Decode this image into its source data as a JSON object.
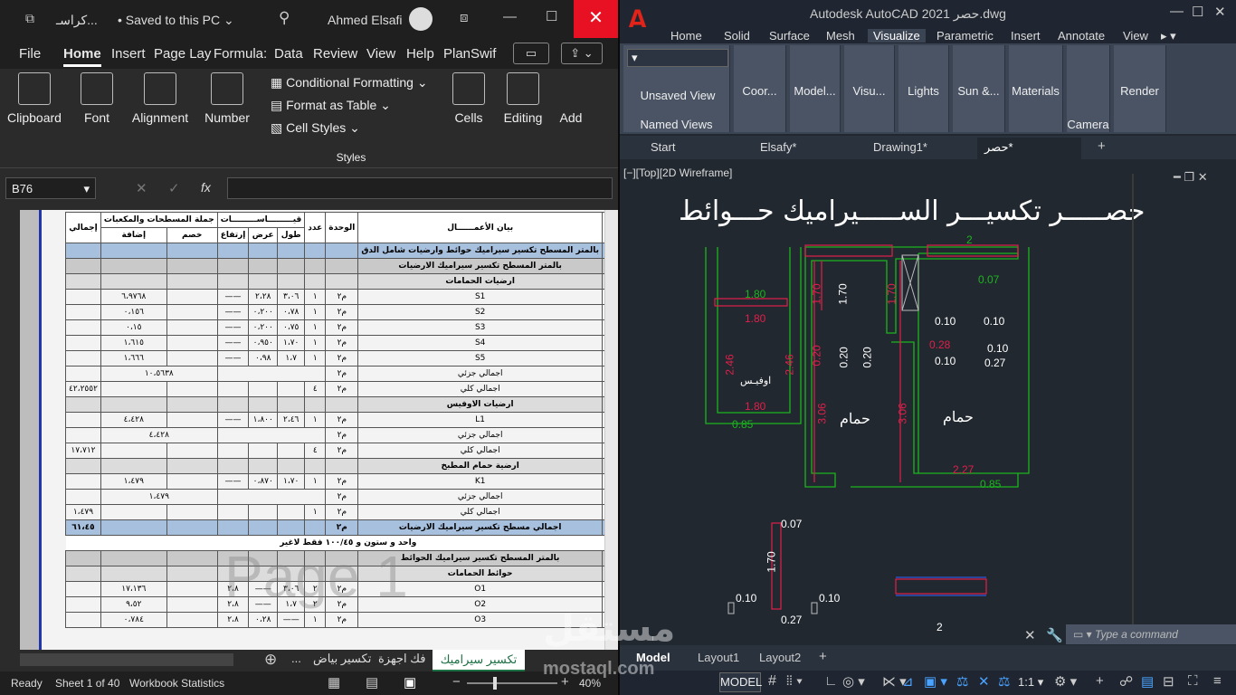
{
  "excel": {
    "title": {
      "filename": "كراسـ...",
      "saved": "Saved to this PC",
      "user": "Ahmed Elsafi"
    },
    "menu": [
      "File",
      "Home",
      "Insert",
      "Page Lay",
      "Formula:",
      "Data",
      "Review",
      "View",
      "Help",
      "PlanSwif"
    ],
    "ribbon": {
      "clipboard": "Clipboard",
      "font": "Font",
      "alignment": "Alignment",
      "number": "Number",
      "conditional": "Conditional Formatting",
      "format_table": "Format as Table",
      "cell_styles": "Cell Styles",
      "styles": "Styles",
      "cells": "Cells",
      "editing": "Editing",
      "add": "Add"
    },
    "name_box": "B76",
    "fx": "fx",
    "sheet": {
      "col_letters": [
        "L",
        "K",
        "J",
        "I",
        "H",
        "G",
        "F",
        "E",
        "D",
        "C",
        "B",
        "A"
      ],
      "header": {
        "total": "إجمالي",
        "sum_group": "جملة المسطحات والمكعبات",
        "measures": "قيـــــــــاســـــــــات",
        "count": "عدد",
        "unit": "الوحدة",
        "desc": "بيان الأعمــــــال",
        "m": "م",
        "add": "إضافة",
        "deduct": "خصم",
        "height": "إرتفاع",
        "width": "عرض",
        "length": "طول"
      },
      "rows": [
        {
          "cls": "blue",
          "m": "١",
          "desc": "بالمتر المسطح تكسير سيراميك حوائط وارضيات شامل الدق"
        },
        {
          "cls": "gray",
          "m": "١ - أ",
          "desc": "بالمتر المسطح تكسير سيراميك الارضيات"
        },
        {
          "cls": "lgray",
          "desc": "ارضيات الحمامات"
        },
        {
          "desc": "S1",
          "unit": "م٢",
          "count": "١",
          "l": "٣،٠٦",
          "w": "٢،٢٨",
          "h": "——",
          "add": "٦،٩٧٦٨"
        },
        {
          "desc": "S2",
          "unit": "م٢",
          "count": "١",
          "l": "٠،٧٨",
          "w": "٠،٢٠٠",
          "h": "——",
          "add": "٠،١٥٦"
        },
        {
          "desc": "S3",
          "unit": "م٢",
          "count": "١",
          "l": "٠،٧٥",
          "w": "٠،٢٠٠",
          "h": "——",
          "add": "٠،١٥"
        },
        {
          "desc": "S4",
          "unit": "م٢",
          "count": "١",
          "l": "١،٧٠",
          "w": "٠،٩٥٠",
          "h": "——",
          "add": "١،٦١٥"
        },
        {
          "desc": "S5",
          "unit": "م٢",
          "count": "١",
          "l": "١،٧",
          "w": "٠،٩٨",
          "h": "——",
          "add": "١،٦٦٦"
        },
        {
          "desc": "اجمالي جزئي",
          "unit": "م٢",
          "sub": "١٠،٥٦٣٨"
        },
        {
          "desc": "اجمالي كلي",
          "unit": "م٢",
          "count": "٤",
          "total": "٤٢،٢٥٥٢"
        },
        {
          "cls": "lgray",
          "desc": "ارضيات الاوفيس"
        },
        {
          "desc": "L1",
          "unit": "م٢",
          "count": "١",
          "l": "٢،٤٦",
          "w": "١،٨٠٠",
          "h": "——",
          "add": "٤،٤٢٨"
        },
        {
          "desc": "اجمالي جزئي",
          "unit": "م٢",
          "sub": "٤،٤٢٨"
        },
        {
          "desc": "اجمالي كلي",
          "unit": "م٢",
          "count": "٤",
          "total": "١٧،٧١٢"
        },
        {
          "cls": "lgray",
          "desc": "ارضية حمام المطبخ"
        },
        {
          "desc": "K1",
          "unit": "م٢",
          "count": "١",
          "l": "١،٧٠",
          "w": "٠،٨٧٠",
          "h": "——",
          "add": "١،٤٧٩"
        },
        {
          "desc": "اجمالي جزئي",
          "unit": "م٢",
          "sub": "١،٤٧٩"
        },
        {
          "desc": "اجمالي كلي",
          "unit": "م٢",
          "count": "١",
          "total": "١،٤٧٩"
        },
        {
          "cls": "blue",
          "desc": "اجمالي مسطح تكسير سيراميك الارضيات",
          "unit": "م٢",
          "total": "٦١،٤٥"
        },
        {
          "note": "واحد و ستون و ١٠٠/٤٥ فقط لاغير"
        },
        {
          "cls": "gray",
          "m": "١ - ب",
          "desc": "بالمتر المسطح تكسير سيراميك الحوائط"
        },
        {
          "cls": "lgray",
          "desc": "حوائط الحمامات"
        },
        {
          "desc": "O1",
          "unit": "م٢",
          "count": "٢",
          "l": "٣،٠٦",
          "w": "——",
          "h": "٢،٨",
          "add": "١٧،١٣٦"
        },
        {
          "desc": "O2",
          "unit": "م٢",
          "count": "٢",
          "l": "١،٧",
          "w": "——",
          "h": "٢،٨",
          "add": "٩،٥٢"
        },
        {
          "desc": "O3",
          "unit": "م٢",
          "count": "١",
          "l": "——",
          "w": "٠،٢٨",
          "h": "٢،٨",
          "add": "٠،٧٨٤"
        }
      ],
      "page_watermark": "Page 1"
    },
    "tabs": [
      "...",
      "تكسير بياض",
      "فك اجهزة",
      "تكسير سيراميك"
    ],
    "status": {
      "ready": "Ready",
      "sheet": "Sheet 1 of 40",
      "stats": "Workbook Statistics",
      "zoom": "40%"
    }
  },
  "acad": {
    "title": "Autodesk AutoCAD 2021  حصر.dwg",
    "tabs": [
      "Home",
      "Solid",
      "Surface",
      "Mesh",
      "Visualize",
      "Parametric",
      "Insert",
      "Annotate",
      "View"
    ],
    "ribbon": {
      "named": "Unsaved View",
      "named_views": "Named Views",
      "coor": "Coor...",
      "model": "Model...",
      "visu": "Visu...",
      "lights": "Lights",
      "sun": "Sun &...",
      "materials": "Materials",
      "camera": "Camera",
      "render": "Render"
    },
    "doc_tabs": [
      "Start",
      "Elsafy*",
      "Drawing1*",
      "حصر*"
    ],
    "viewport_label": "[−][Top][2D Wireframe]",
    "drawing_title": "حصـــــر تكسيـــر الســـــيراميك حـــوائط",
    "labels": {
      "hammam": "حمام",
      "office": "اوفيـس"
    },
    "dims": [
      "2",
      "1.80",
      "1.80",
      "1.80",
      "2.46",
      "2.46",
      "0.85",
      "3.06",
      "3.06",
      "1.70",
      "1.70",
      "1.70",
      "0.20",
      "0.20",
      "0.20",
      "0.10",
      "0.10",
      "0.10",
      "0.10",
      "0.27",
      "0.28",
      "0.07",
      "2.27",
      "0.85"
    ],
    "command_placeholder": "Type a command",
    "layout_tabs": [
      "Model",
      "Layout1",
      "Layout2"
    ],
    "status_model": "MODEL",
    "scale": "1:1"
  },
  "watermark": {
    "ar": "مستقل",
    "en": "mostaql.com"
  }
}
